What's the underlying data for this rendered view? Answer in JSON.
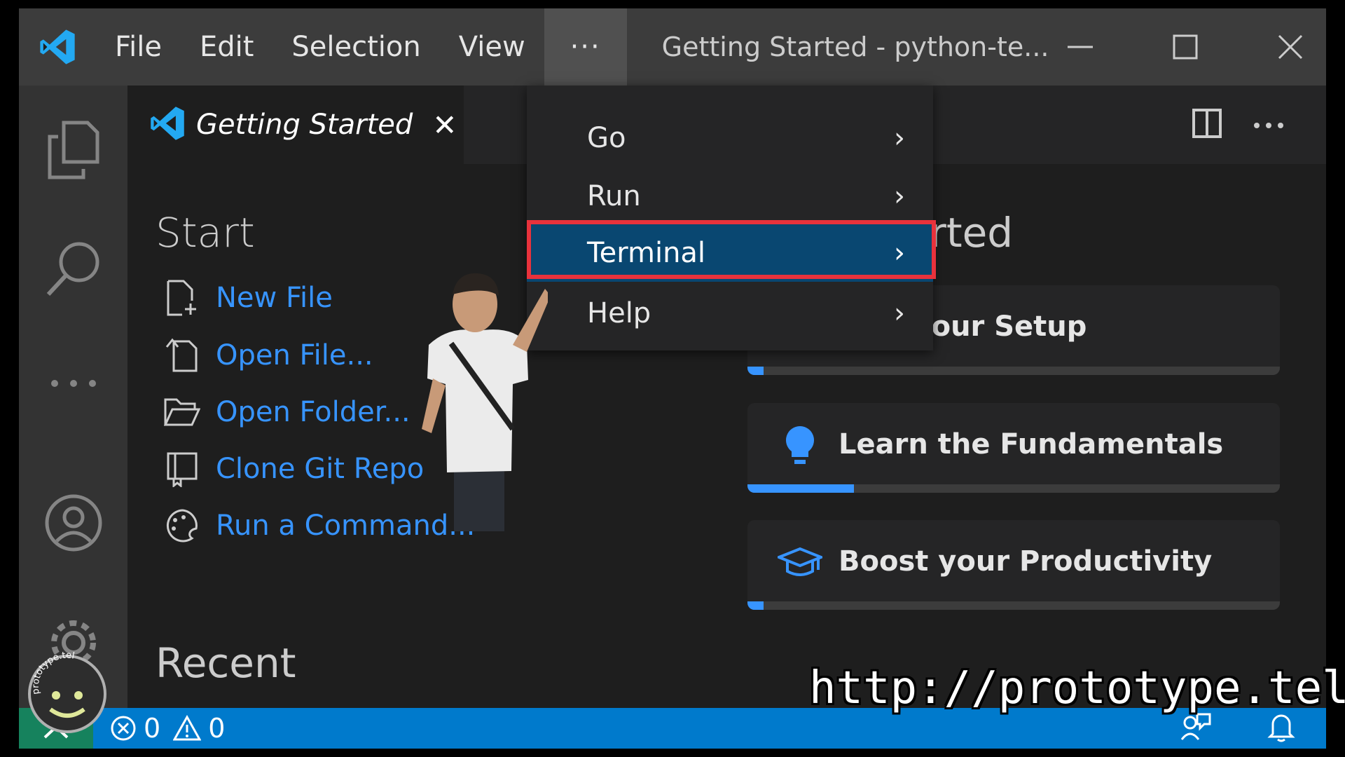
{
  "titlebar": {
    "menu": [
      "File",
      "Edit",
      "Selection",
      "View"
    ],
    "more": "···",
    "window_title": "Getting Started - python-te..."
  },
  "tab": {
    "label": "Getting Started",
    "close": "✕"
  },
  "dropdown": {
    "items": [
      {
        "label": "Go",
        "chevron": "›"
      },
      {
        "label": "Run",
        "chevron": "›"
      },
      {
        "label": "Terminal",
        "chevron": "›",
        "active": true
      },
      {
        "label": "Help",
        "chevron": "›"
      }
    ]
  },
  "start": {
    "title": "Start",
    "links": [
      {
        "label": "New File",
        "icon": "new-file-icon"
      },
      {
        "label": "Open File...",
        "icon": "open-file-icon"
      },
      {
        "label": "Open Folder...",
        "icon": "open-folder-icon"
      },
      {
        "label": "Clone Git Repo",
        "icon": "clone-repo-icon"
      },
      {
        "label": "Run a Command...",
        "icon": "command-palette-icon"
      }
    ]
  },
  "recent": {
    "title": "Recent"
  },
  "walkthrough": {
    "title_visible": "rted",
    "cards": [
      {
        "label": "nize your Setup",
        "icon": "setup-icon",
        "progress": 0.03
      },
      {
        "label": "Learn the Fundamentals",
        "icon": "lightbulb-icon",
        "progress": 0.2
      },
      {
        "label": "Boost your Productivity",
        "icon": "mortarboard-icon",
        "progress": 0.03
      }
    ]
  },
  "statusbar": {
    "errors": "0",
    "warnings": "0"
  },
  "watermark": {
    "url": "http://prototype.tel",
    "logo_text": "prototype.tel"
  },
  "colors": {
    "accent": "#007acc",
    "link": "#3794ff",
    "menu_active": "#094771",
    "highlight_box": "#e8323c",
    "remote": "#16825d"
  }
}
